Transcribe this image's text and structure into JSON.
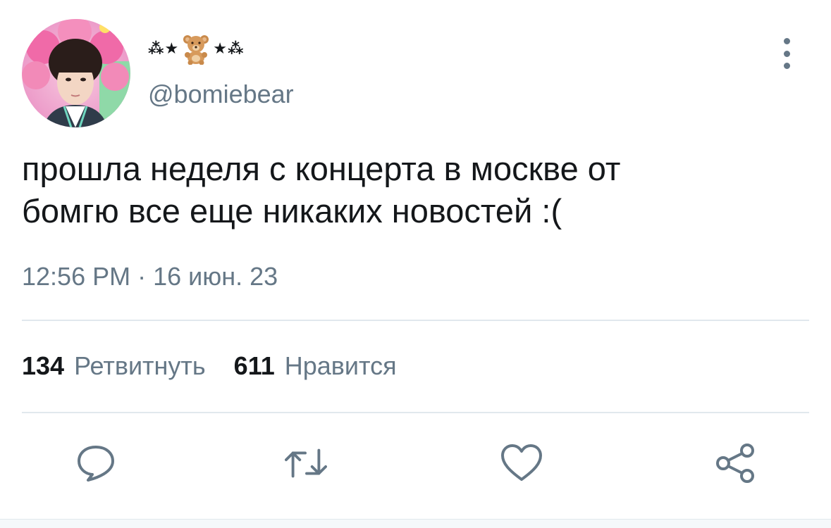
{
  "author": {
    "display_name_left": "⁂★",
    "display_name_right": "★⁂",
    "emoji": "teddy-bear",
    "handle": "@bomiebear",
    "avatar": "avatar-photo"
  },
  "tweet": {
    "line1": "прошла неделя с концерта в москве от",
    "line2": "бомгю все еще никаких новостей :(",
    "timestamp": "12:56 PM · 16 июн. 23"
  },
  "stats": {
    "retweets_count": "134",
    "retweets_label": "Ретвитнуть",
    "likes_count": "611",
    "likes_label": "Нравится"
  },
  "actions": {
    "reply": "reply-icon",
    "retweet": "retweet-icon",
    "like": "heart-icon",
    "share": "share-icon"
  },
  "colors": {
    "text_primary": "#14171a",
    "text_secondary": "#657786",
    "divider": "#e1e8ed",
    "icon": "#657786"
  }
}
